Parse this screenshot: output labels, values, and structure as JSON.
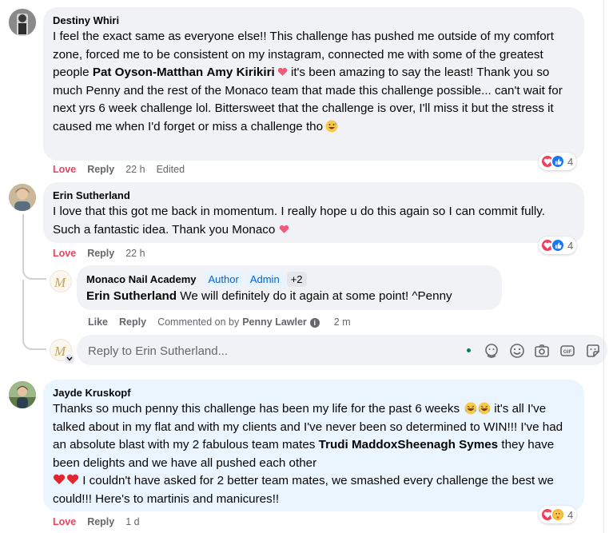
{
  "comments": [
    {
      "author": "Destiny Whiri",
      "text_1": "I feel the exact same as everyone else!! This challenge has pushed me outside of my comfort zone, forced me to be consistent on my instagram, connected me with some of the greatest people ",
      "tag_1": "Pat Oyson-Matthan",
      "tag_2": "Amy Kirikiri",
      "text_2": " it's been amazing to say the least! Thank you so much Penny and the rest of the Monaco team that made this challenge possible... can't wait for next yrs 6 week challenge lol. Bittersweet that the challenge is over, I'll miss it but the stress it caused me when I'd forget or miss a challenge tho",
      "actions": {
        "love": "Love",
        "reply": "Reply",
        "time": "22 h",
        "edited": "Edited"
      },
      "reactions_count": "4"
    },
    {
      "author": "Erin Sutherland",
      "text": "I love that this got me back in momentum. I really hope u do this again so I can commit fully. Such a fantastic idea. Thank you Monaco",
      "actions": {
        "love": "Love",
        "reply": "Reply",
        "time": "22 h"
      },
      "reactions_count": "4"
    },
    {
      "author": "Jayde Kruskopf",
      "text_1": "Thanks so much penny this challenge has been my life for the past 6 weeks",
      "text_2": " it's all I've talked about in my flat and with my clients and I've never been so determined to WIN!!! I've had an absolute blast with my 2 fabulous team mates ",
      "tag_1": "Trudi MaddoxSheenagh Symes",
      "text_3": " they have been delights and we have all pushed each other",
      "text_4": " I couldn't have asked for 2 better team mates, we smashed every challenge the best we could!!! Here's to martinis and manicures!!",
      "actions": {
        "love": "Love",
        "reply": "Reply",
        "time": "1 d"
      },
      "reactions_count": "4"
    }
  ],
  "reply": {
    "author": "Monaco Nail Academy",
    "badges": [
      "Author",
      "Admin",
      "+2"
    ],
    "mention": "Erin Sutherland",
    "text": " We will definitely do it again at some point! ^Penny",
    "actions": {
      "like": "Like",
      "reply": "Reply",
      "commented_on": "Commented on by",
      "commenter": "Penny Lawler",
      "time": "2 m"
    }
  },
  "reply_box": {
    "placeholder": "Reply to Erin Sutherland...",
    "tools": [
      "emoji-icon",
      "camera-icon",
      "gif-icon",
      "sticker-icon"
    ]
  },
  "colors": {
    "love": "#f33e58",
    "like_blue": "#1877f2",
    "badge_blue": "#0064d1",
    "bubble": "#f0f2f5",
    "bubble_highlight": "#ebf5ff",
    "muted": "#65676b"
  }
}
